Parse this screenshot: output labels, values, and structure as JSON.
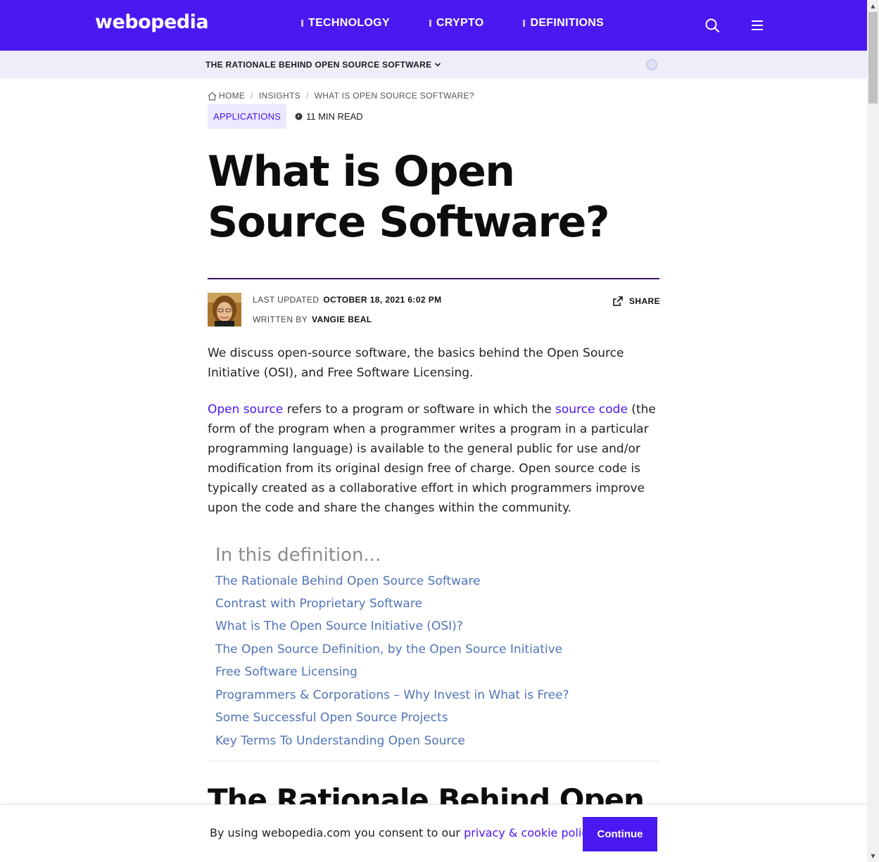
{
  "header": {
    "logo": "webopedia",
    "nav": [
      {
        "label": "TECHNOLOGY"
      },
      {
        "label": "CRYPTO"
      },
      {
        "label": "DEFINITIONS"
      }
    ],
    "search_icon": "search-icon",
    "menu_icon": "hamburger-menu-icon",
    "accent_color": "#4a18f0"
  },
  "subbar": {
    "title": "THE RATIONALE BEHIND OPEN SOURCE SOFTWARE"
  },
  "breadcrumb": {
    "home": "HOME",
    "items": [
      "INSIGHTS",
      "WHAT IS OPEN SOURCE SOFTWARE?"
    ],
    "separator": "/"
  },
  "article": {
    "category": "APPLICATIONS",
    "read_time": "11 MIN READ",
    "title": "What is Open Source Software?",
    "meta": {
      "updated_label": "LAST UPDATED",
      "updated_value": "OCTOBER 18, 2021 6:02 PM",
      "written_label": "WRITTEN BY",
      "author": "VANGIE BEAL",
      "share": "SHARE"
    },
    "intro": "We discuss open-source software, the basics behind the Open Source Initiative (OSI), and Free Software Licensing.",
    "para2": {
      "link1": "Open source",
      "text1": " refers to a program or software in which the ",
      "link2": "source code",
      "text2": " (the form of the program when a programmer writes a program in a particular programming language) is available to the general public for use and/or modification from its original design free of charge. Open source code is typically created as a collaborative effort in which programmers improve upon the code and share the changes within the community."
    },
    "toc": {
      "heading": "In this definition...",
      "items": [
        "The Rationale Behind Open Source Software",
        "Contrast with Proprietary Software",
        "What is The Open Source Initiative (OSI)?",
        "The Open Source Definition, by the Open Source Initiative",
        "Free Software Licensing",
        "Programmers & Corporations – Why Invest in What is Free?",
        "Some Successful Open Source Projects",
        "Key Terms To Understanding Open Source"
      ]
    },
    "section_heading": "The Rationale Behind Open"
  },
  "cookie": {
    "text": "By using webopedia.com you consent to our ",
    "link": "privacy & cookie policy",
    "period": ".",
    "button": "Continue"
  }
}
